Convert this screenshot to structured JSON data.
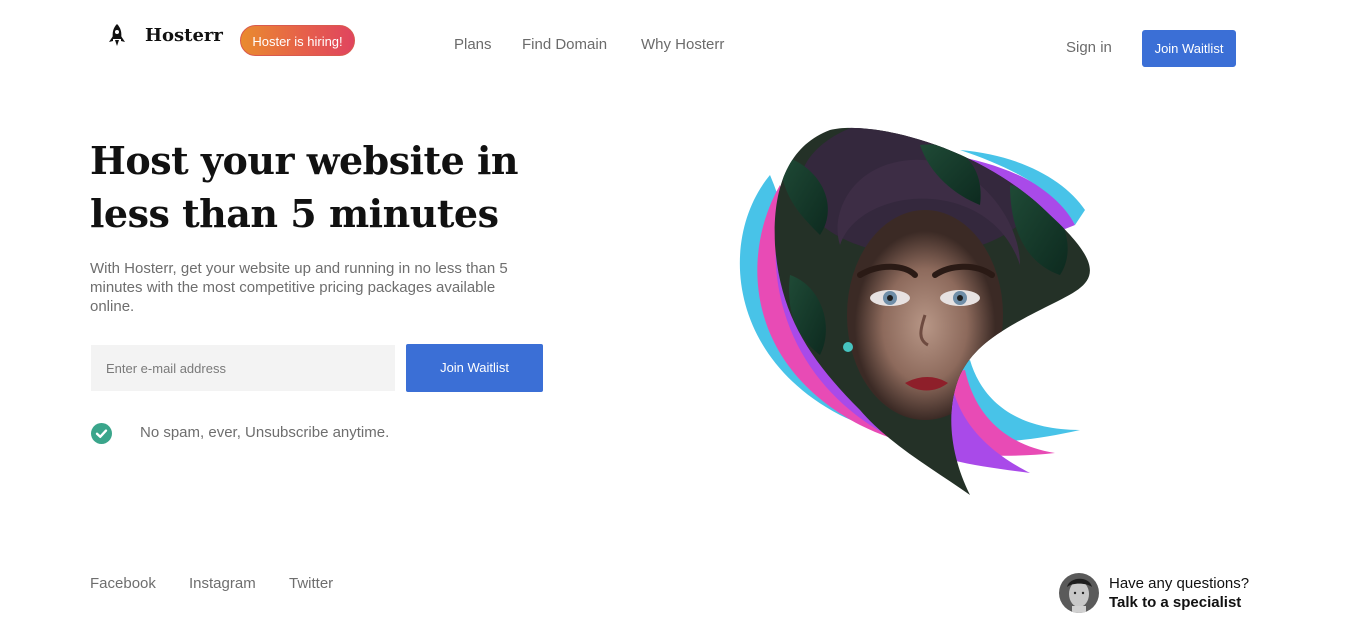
{
  "brand": {
    "name": "Hosterr",
    "logo_icon": "rocket-icon"
  },
  "header": {
    "hiring_badge": "Hoster is hiring!",
    "nav": [
      "Plans",
      "Find Domain",
      "Why Hosterr"
    ],
    "sign_in": "Sign in",
    "join_waitlist": "Join Waitlist"
  },
  "hero": {
    "headline": "Host your website in less than 5 minutes",
    "subtext": "With Hosterr, get your website up and running in no less than 5 minutes with the most competitive pricing packages available online.",
    "email_placeholder": "Enter e-mail address",
    "join_waitlist": "Join Waitlist",
    "no_spam": "No spam, ever, Unsubscribe anytime.",
    "check_icon": "check-circle-icon"
  },
  "footer": {
    "social": [
      "Facebook",
      "Instagram",
      "Twitter"
    ],
    "question": "Have any questions?",
    "specialist": "Talk to a specialist"
  },
  "colors": {
    "primary": "#3b6fd6",
    "badge_start": "#e98b2f",
    "badge_end": "#e0445f",
    "check": "#3aa58b",
    "purple": "#a94ae9",
    "pink": "#e84bb5",
    "cyan": "#48c3e8"
  }
}
